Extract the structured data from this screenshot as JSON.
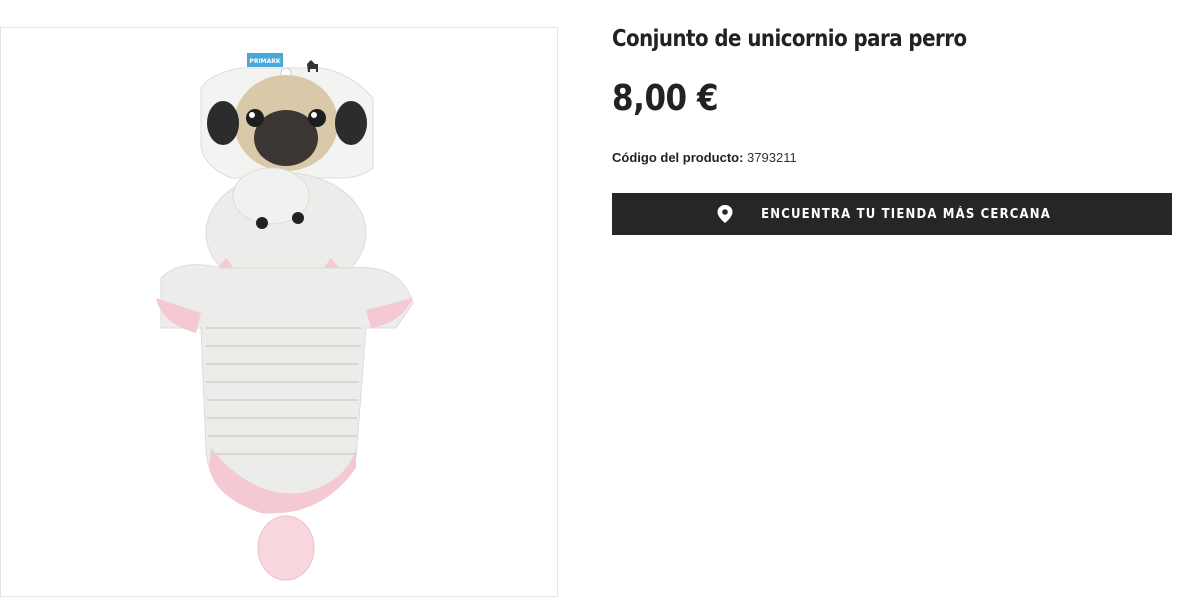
{
  "product": {
    "title": "Conjunto de unicornio para perro",
    "price": "8,00 €",
    "code_label": "Código del producto:",
    "code_value": "3793211",
    "image": {
      "brand_tag": "PRIMARK"
    }
  },
  "actions": {
    "find_store_label": "ENCUENTRA TU TIENDA MÁS CERCANA",
    "find_store_icon": "map-pin-icon"
  },
  "colors": {
    "button_bg": "#262626",
    "text": "#222222",
    "brand_tag": "#4aa8d8",
    "costume_white": "#ececea",
    "costume_pink": "#f4c9d3",
    "horn_gold": "#d9b24a"
  }
}
